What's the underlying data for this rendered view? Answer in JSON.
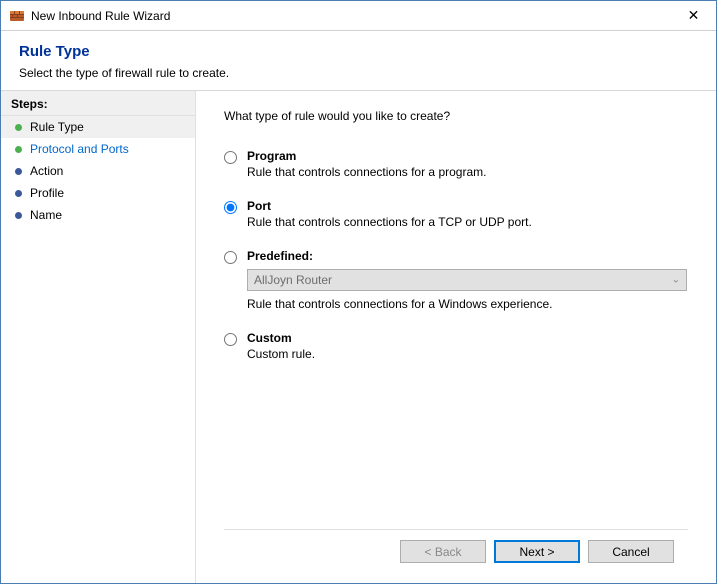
{
  "titlebar": {
    "title": "New Inbound Rule Wizard",
    "close": "✕"
  },
  "header": {
    "title": "Rule Type",
    "subtitle": "Select the type of firewall rule to create."
  },
  "sidebar": {
    "heading": "Steps:",
    "items": [
      {
        "label": "Rule Type",
        "state": "done",
        "current": true
      },
      {
        "label": "Protocol and Ports",
        "state": "done",
        "link": true
      },
      {
        "label": "Action",
        "state": "pending"
      },
      {
        "label": "Profile",
        "state": "pending"
      },
      {
        "label": "Name",
        "state": "pending"
      }
    ]
  },
  "content": {
    "question": "What type of rule would you like to create?",
    "options": {
      "program": {
        "title": "Program",
        "desc": "Rule that controls connections for a program."
      },
      "port": {
        "title": "Port",
        "desc": "Rule that controls connections for a TCP or UDP port."
      },
      "predefined": {
        "title": "Predefined:",
        "selected": "AllJoyn Router",
        "desc": "Rule that controls connections for a Windows experience."
      },
      "custom": {
        "title": "Custom",
        "desc": "Custom rule."
      }
    }
  },
  "footer": {
    "back": "< Back",
    "next": "Next >",
    "cancel": "Cancel"
  }
}
